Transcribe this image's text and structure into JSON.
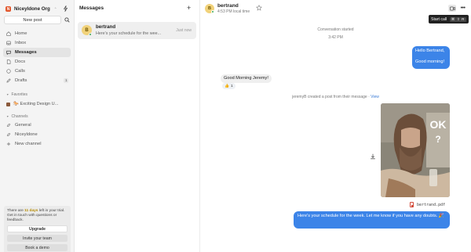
{
  "sidebar": {
    "org_name": "Niceyldone Org",
    "org_initial": "N",
    "new_post_label": "New post",
    "nav": [
      {
        "label": "Home",
        "icon": "home-icon"
      },
      {
        "label": "Inbox",
        "icon": "inbox-icon"
      },
      {
        "label": "Messages",
        "icon": "messages-icon",
        "active": true
      },
      {
        "label": "Docs",
        "icon": "docs-icon"
      },
      {
        "label": "Calls",
        "icon": "calls-icon"
      },
      {
        "label": "Drafts",
        "icon": "drafts-icon",
        "count": "1"
      }
    ],
    "favorites_heading": "Favorites",
    "favorites": [
      {
        "label": "🐎 Exciting Design U..."
      }
    ],
    "channels_heading": "Channels",
    "channels": [
      {
        "label": "General",
        "icon": "channel-icon"
      },
      {
        "label": "Niceyldone",
        "icon": "channel-icon"
      },
      {
        "label": "New channel",
        "icon": "plus-icon"
      }
    ],
    "trial": {
      "text_before": "There are ",
      "days": "11 days",
      "text_after": " left in your trial. Get in touch with questions or feedback.",
      "upgrade_label": "Upgrade",
      "invite_label": "Invite your team",
      "demo_label": "Book a demo"
    }
  },
  "messages_list": {
    "title": "Messages",
    "conversations": [
      {
        "avatar": "B",
        "name": "bertrand",
        "preview": "Here's your schedule for the wee...",
        "time": "Just now"
      }
    ]
  },
  "chat": {
    "contact_name": "bertrand",
    "contact_initial": "B",
    "local_time": "4:53 PM local time",
    "tooltip_label": "Start call",
    "tooltip_shortcut": "⌘ ⇧ R",
    "conversation_started": "Conversation started",
    "started_time": "3:42 PM",
    "msg_out_1_line1": "Hello Bertrand,",
    "msg_out_1_line2": "Good morning!",
    "msg_in_1": "Good Morning Jeremy!",
    "reaction_emoji": "👍",
    "reaction_count": "1",
    "post_notice": "jeremyB created a post from their message · ",
    "post_notice_link": "View",
    "image_text_top": "OK",
    "image_text_bottom": "?",
    "file_name": "bertrand.pdf",
    "msg_out_2": "Here's your schedule for the week. Let me know if you have any doubts. 🎉"
  },
  "colors": {
    "accent": "#3c84e8",
    "org_logo": "#e2572d",
    "online": "#36a852",
    "avatar": "#f1d27a"
  }
}
